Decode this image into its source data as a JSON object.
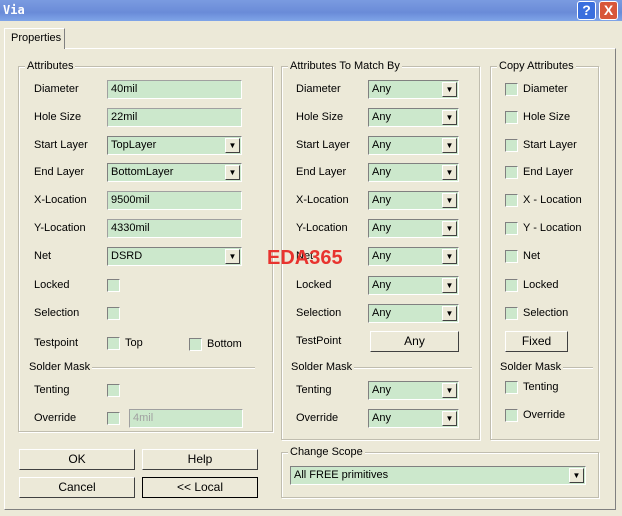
{
  "window": {
    "title": "Via",
    "help_icon": "?",
    "close_icon": "X"
  },
  "tab": "Properties",
  "attributes": {
    "title": "Attributes",
    "rows": [
      {
        "label": "Diameter",
        "type": "field",
        "value": "40mil"
      },
      {
        "label": "Hole Size",
        "type": "field",
        "value": "22mil"
      },
      {
        "label": "Start Layer",
        "type": "select",
        "value": "TopLayer"
      },
      {
        "label": "End Layer",
        "type": "select",
        "value": "BottomLayer"
      },
      {
        "label": "X-Location",
        "type": "field",
        "value": "9500mil"
      },
      {
        "label": "Y-Location",
        "type": "field",
        "value": "4330mil"
      },
      {
        "label": "Net",
        "type": "select",
        "value": "DSRD"
      },
      {
        "label": "Locked",
        "type": "checkbox"
      },
      {
        "label": "Selection",
        "type": "checkbox"
      }
    ],
    "testpoint": {
      "label": "Testpoint",
      "top": "Top",
      "bottom": "Bottom"
    },
    "solder_mask": "Solder Mask",
    "tenting": "Tenting",
    "override": "Override",
    "override_value": "4mil"
  },
  "match": {
    "title": "Attributes To Match By",
    "labels": [
      "Diameter",
      "Hole Size",
      "Start Layer",
      "End Layer",
      "X-Location",
      "Y-Location",
      "Net",
      "Locked",
      "Selection"
    ],
    "values": [
      "Any",
      "Any",
      "Any",
      "Any",
      "Any",
      "Any",
      "Any",
      "Any",
      "Any"
    ],
    "testpoint_label": "TestPoint",
    "testpoint_value": "Any",
    "solder_mask": "Solder Mask",
    "tenting": "Tenting",
    "tenting_value": "Any",
    "override": "Override",
    "override_value": "Any"
  },
  "copy": {
    "title": "Copy Attributes",
    "labels": [
      "Diameter",
      "Hole Size",
      "Start Layer",
      "End Layer",
      "X - Location",
      "Y - Location",
      "Net",
      "Locked",
      "Selection"
    ],
    "fixed": "Fixed",
    "solder_mask": "Solder Mask",
    "tenting": "Tenting",
    "override": "Override"
  },
  "buttons": {
    "ok": "OK",
    "help": "Help",
    "cancel": "Cancel",
    "local": "<< Local"
  },
  "scope": {
    "title": "Change Scope",
    "value": "All FREE primitives"
  },
  "watermark": "EDA365"
}
